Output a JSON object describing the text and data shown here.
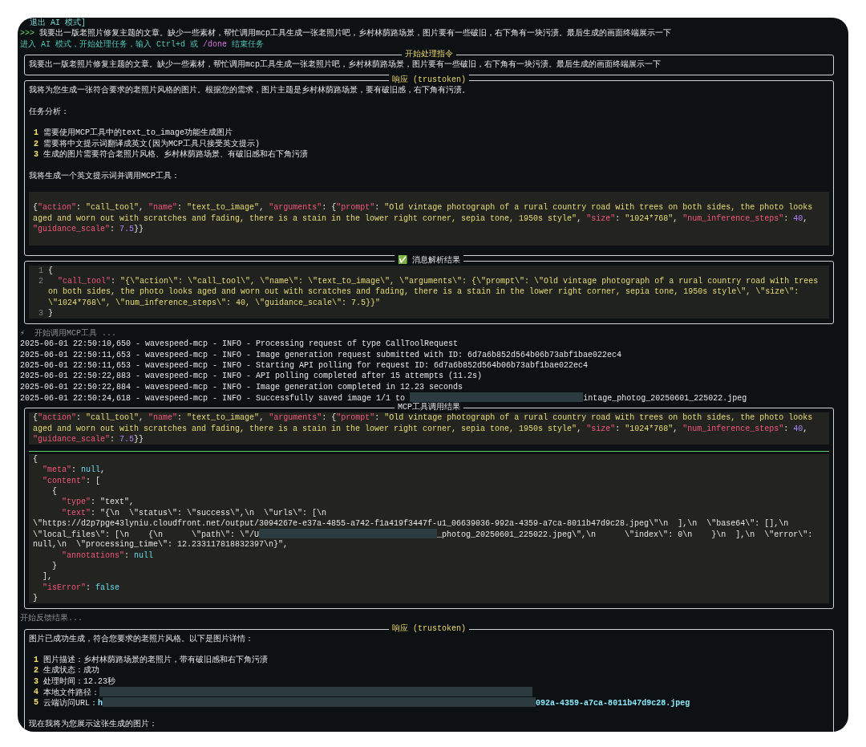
{
  "top_line": "退出 AI 模式]",
  "input_line": {
    "prompt": ">>>",
    "text": "我要出一版老照片修复主题的文章。缺少一些素材，帮忙调用mcp工具生成一张老照片吧，乡村林荫路场景，图片要有一些破旧，右下角有一块污渍。最后生成的画面终端展示一下"
  },
  "mode_hint": {
    "parts": [
      {
        "kind": "info",
        "text": "进入 AI 模式，开始处理任务，输入 Ctrl+d 或 "
      },
      {
        "kind": "command",
        "text": "/done"
      },
      {
        "kind": "info",
        "text": " 结束任务"
      }
    ]
  },
  "blocks": [
    {
      "kind": "panel",
      "title": "开始处理指令",
      "accent": true,
      "content": [
        {
          "kind": "text",
          "text": "我要出一版老照片修复主题的文章。缺少一些素材，帮忙调用mcp工具生成一张老照片吧，乡村林荫路场景，图片要有一些破旧，右下角有一块污渍。最后生成的画面终端展示一下"
        }
      ]
    },
    {
      "kind": "panel",
      "title": "响应 (trustoken)",
      "accent": true,
      "content": [
        {
          "kind": "text",
          "text": "我将为您生成一张符合要求的老照片风格的图片。根据您的需求，图片主题是乡村林荫路场景，要有破旧感，右下角有污渍。"
        },
        {
          "kind": "blank"
        },
        {
          "kind": "text",
          "text": "任务分析："
        },
        {
          "kind": "blank"
        },
        {
          "kind": "list",
          "items": [
            {
              "num": "1",
              "text": "需要使用MCP工具中的text_to_image功能生成图片"
            },
            {
              "num": "2",
              "text": "需要将中文提示词翻译成英文(因为MCP工具只接受英文提示)"
            },
            {
              "num": "3",
              "text": "生成的图片需要符合老照片风格、乡村林荫路场景、有破旧感和右下角污渍"
            }
          ]
        },
        {
          "kind": "blank"
        },
        {
          "kind": "text",
          "text": "我将生成一个英文提示词并调用MCP工具："
        },
        {
          "kind": "blank"
        },
        {
          "kind": "code",
          "padded": true,
          "rows": [
            {
              "parts": [
                {
                  "kind": "plain",
                  "text": "{"
                },
                {
                  "kind": "key",
                  "text": "\"action\""
                },
                {
                  "kind": "plain",
                  "text": ": "
                },
                {
                  "kind": "string",
                  "text": "\"call_tool\""
                },
                {
                  "kind": "plain",
                  "text": ", "
                },
                {
                  "kind": "key",
                  "text": "\"name\""
                },
                {
                  "kind": "plain",
                  "text": ": "
                },
                {
                  "kind": "string",
                  "text": "\"text_to_image\""
                },
                {
                  "kind": "plain",
                  "text": ", "
                },
                {
                  "kind": "key",
                  "text": "\"arguments\""
                },
                {
                  "kind": "plain",
                  "text": ": {"
                },
                {
                  "kind": "key",
                  "text": "\"prompt\""
                },
                {
                  "kind": "plain",
                  "text": ": "
                },
                {
                  "kind": "string",
                  "text": "\"Old vintage photograph of a rural country road with trees on both sides, the photo looks"
                }
              ]
            },
            {
              "parts": [
                {
                  "kind": "string",
                  "text": "aged and worn out with scratches and fading, there is a stain in the lower right corner, sepia tone, 1950s style\""
                },
                {
                  "kind": "plain",
                  "text": ", "
                },
                {
                  "kind": "key",
                  "text": "\"size\""
                },
                {
                  "kind": "plain",
                  "text": ": "
                },
                {
                  "kind": "string",
                  "text": "\"1024*768\""
                },
                {
                  "kind": "plain",
                  "text": ", "
                },
                {
                  "kind": "key",
                  "text": "\"num_inference_steps\""
                },
                {
                  "kind": "plain",
                  "text": ": "
                },
                {
                  "kind": "number",
                  "text": "40"
                },
                {
                  "kind": "plain",
                  "text": ","
                }
              ]
            },
            {
              "parts": [
                {
                  "kind": "key",
                  "text": "\"guidance_scale\""
                },
                {
                  "kind": "plain",
                  "text": ": "
                },
                {
                  "kind": "number",
                  "text": "7.5"
                },
                {
                  "kind": "plain",
                  "text": "}}"
                }
              ]
            }
          ]
        }
      ]
    },
    {
      "kind": "panel",
      "title": "✅ 消息解析结果",
      "accent": false,
      "content": [
        {
          "kind": "numbered_code",
          "lines": [
            {
              "num": "1",
              "rows": [
                {
                  "parts": [
                    {
                      "kind": "plain",
                      "text": "{"
                    }
                  ]
                }
              ]
            },
            {
              "num": "2",
              "rows": [
                {
                  "parts": [
                    {
                      "kind": "key",
                      "text": "  \"call_tool\""
                    },
                    {
                      "kind": "plain",
                      "text": ": "
                    },
                    {
                      "kind": "string",
                      "text": "\"{\\\"action\\\": \\\"call_tool\\\", \\\"name\\\": \\\"text_to_image\\\", \\\"arguments\\\": {\\\"prompt\\\": \\\"Old vintage photograph of a rural country road with trees"
                    }
                  ]
                },
                {
                  "parts": [
                    {
                      "kind": "string",
                      "text": "on both sides, the photo looks aged and worn out with scratches and fading, there is a stain in the lower right corner, sepia tone, 1950s style\\\", \\\"size\\\":"
                    }
                  ]
                },
                {
                  "parts": [
                    {
                      "kind": "string",
                      "text": "\\\"1024*768\\\", \\\"num_inference_steps\\\": 40, \\\"guidance_scale\\\": 7.5}}\""
                    }
                  ]
                }
              ]
            },
            {
              "num": "3",
              "rows": [
                {
                  "parts": [
                    {
                      "kind": "plain",
                      "text": "}"
                    }
                  ]
                }
              ]
            }
          ]
        }
      ]
    },
    {
      "kind": "status",
      "parts": [
        {
          "kind": "dim",
          "text": "⚡  开始调用MCP工具 ..."
        }
      ]
    },
    {
      "kind": "log",
      "rows": [
        {
          "parts": [
            {
              "kind": "plain",
              "text": "2025-06-01 22:50:10,650 - wavespeed-mcp - INFO - Processing request of type CallToolRequest"
            }
          ]
        },
        {
          "parts": [
            {
              "kind": "plain",
              "text": "2025-06-01 22:50:11,653 - wavespeed-mcp - INFO - Image generation request submitted with ID: 6d7a6b852d564b06b73abf1bae022ec4"
            }
          ]
        },
        {
          "parts": [
            {
              "kind": "plain",
              "text": "2025-06-01 22:50:11,653 - wavespeed-mcp - INFO - Starting API polling for request ID: 6d7a6b852d564b06b73abf1bae022ec4"
            }
          ]
        },
        {
          "parts": [
            {
              "kind": "plain",
              "text": "2025-06-01 22:50:22,883 - wavespeed-mcp - INFO - API polling completed after 15 attempts (11.2s)"
            }
          ]
        },
        {
          "parts": [
            {
              "kind": "plain",
              "text": "2025-06-01 22:50:22,884 - wavespeed-mcp - INFO - Image generation completed in 12.23 seconds"
            }
          ]
        },
        {
          "parts": [
            {
              "kind": "plain",
              "text": "2025-06-01 22:50:24,618 - wavespeed-mcp - INFO - Successfully saved image 1/1 to "
            },
            {
              "kind": "redaction_short"
            },
            {
              "kind": "plain",
              "text": "intage_photog_20250601_225022.jpeg"
            }
          ]
        }
      ]
    },
    {
      "kind": "panel",
      "title": "MCP工具调用结果",
      "accent": false,
      "content": [
        {
          "kind": "code",
          "padded": false,
          "rows": [
            {
              "parts": [
                {
                  "kind": "plain",
                  "text": "{"
                },
                {
                  "kind": "key",
                  "text": "\"action\""
                },
                {
                  "kind": "plain",
                  "text": ": "
                },
                {
                  "kind": "string",
                  "text": "\"call_tool\""
                },
                {
                  "kind": "plain",
                  "text": ", "
                },
                {
                  "kind": "key",
                  "text": "\"name\""
                },
                {
                  "kind": "plain",
                  "text": ": "
                },
                {
                  "kind": "string",
                  "text": "\"text_to_image\""
                },
                {
                  "kind": "plain",
                  "text": ", "
                },
                {
                  "kind": "key",
                  "text": "\"arguments\""
                },
                {
                  "kind": "plain",
                  "text": ": {"
                },
                {
                  "kind": "key",
                  "text": "\"prompt\""
                },
                {
                  "kind": "plain",
                  "text": ": "
                },
                {
                  "kind": "string",
                  "text": "\"Old vintage photograph of a rural country road with trees on both sides, the photo looks"
                }
              ]
            },
            {
              "parts": [
                {
                  "kind": "string",
                  "text": "aged and worn out with scratches and fading, there is a stain in the lower right corner, sepia tone, 1950s style\""
                },
                {
                  "kind": "plain",
                  "text": ", "
                },
                {
                  "kind": "key",
                  "text": "\"size\""
                },
                {
                  "kind": "plain",
                  "text": ": "
                },
                {
                  "kind": "string",
                  "text": "\"1024*768\""
                },
                {
                  "kind": "plain",
                  "text": ", "
                },
                {
                  "kind": "key",
                  "text": "\"num_inference_steps\""
                },
                {
                  "kind": "plain",
                  "text": ": "
                },
                {
                  "kind": "number",
                  "text": "40"
                },
                {
                  "kind": "plain",
                  "text": ","
                }
              ]
            },
            {
              "parts": [
                {
                  "kind": "key",
                  "text": "\"guidance_scale\""
                },
                {
                  "kind": "plain",
                  "text": ": "
                },
                {
                  "kind": "number",
                  "text": "7.5"
                },
                {
                  "kind": "plain",
                  "text": "}}"
                }
              ]
            }
          ]
        },
        {
          "kind": "divider"
        },
        {
          "kind": "code",
          "padded": false,
          "rows": [
            {
              "parts": [
                {
                  "kind": "plain",
                  "text": "{"
                }
              ]
            },
            {
              "parts": [
                {
                  "kind": "key",
                  "text": "  \"meta\""
                },
                {
                  "kind": "plain",
                  "text": ": "
                },
                {
                  "kind": "const",
                  "text": "null"
                },
                {
                  "kind": "plain",
                  "text": ","
                }
              ]
            },
            {
              "parts": [
                {
                  "kind": "key",
                  "text": "  \"content\""
                },
                {
                  "kind": "plain",
                  "text": ": ["
                }
              ]
            },
            {
              "parts": [
                {
                  "kind": "plain",
                  "text": "    {"
                }
              ]
            },
            {
              "parts": [
                {
                  "kind": "key",
                  "text": "      \"type\""
                },
                {
                  "kind": "plain",
                  "text": ": \"text\","
                }
              ]
            },
            {
              "parts": [
                {
                  "kind": "key",
                  "text": "      \"text\""
                },
                {
                  "kind": "plain",
                  "text": ": \"{\\n  \\\"status\\\": \\\"success\\\",\\n  \\\"urls\\\": [\\n"
                }
              ]
            },
            {
              "parts": [
                {
                  "kind": "plain",
                  "text": "\\\"https://d2p7pge43lyniu.cloudfront.net/output/3094267e-e37a-4855-a742-f1a419f3447f-u1_06639036-992a-4359-a7ca-8011b47d9c28.jpeg\\\"\\n  ],\\n  \\\"base64\\\": [],\\n"
                }
              ]
            },
            {
              "parts": [
                {
                  "kind": "plain",
                  "text": "\\\"local_files\\\": [\\n    {\\n      \\\"path\\\": \\\"/U"
                },
                {
                  "kind": "redaction_medium"
                },
                {
                  "kind": "plain",
                  "text": "_photog_20250601_225022.jpeg\\\",\\n      \\\"index\\\": 0\\n    }\\n  ],\\n  \\\"error\\\":"
                }
              ]
            },
            {
              "parts": [
                {
                  "kind": "plain",
                  "text": "null,\\n  \\\"processing_time\\\": 12.233117818832397\\n}\","
                }
              ]
            },
            {
              "parts": [
                {
                  "kind": "key",
                  "text": "      \"annotations\""
                },
                {
                  "kind": "plain",
                  "text": ": "
                },
                {
                  "kind": "const",
                  "text": "null"
                }
              ]
            },
            {
              "parts": [
                {
                  "kind": "plain",
                  "text": "    }"
                }
              ]
            },
            {
              "parts": [
                {
                  "kind": "plain",
                  "text": "  ],"
                }
              ]
            },
            {
              "parts": [
                {
                  "kind": "key",
                  "text": "  \"isError\""
                },
                {
                  "kind": "plain",
                  "text": ": "
                },
                {
                  "kind": "const",
                  "text": "false"
                }
              ]
            },
            {
              "parts": [
                {
                  "kind": "plain",
                  "text": "}"
                }
              ]
            }
          ]
        }
      ]
    },
    {
      "kind": "status",
      "parts": [
        {
          "kind": "dim",
          "text": "开始反馈结果..."
        }
      ]
    },
    {
      "kind": "panel",
      "title": "响应 (trustoken)",
      "accent": true,
      "content": [
        {
          "kind": "text",
          "text": "图片已成功生成，符合您要求的老照片风格。以下是图片详情："
        },
        {
          "kind": "blank"
        },
        {
          "kind": "list",
          "items": [
            {
              "num": "1",
              "text": "图片描述：乡村林荫路场景的老照片，带有破旧感和右下角污渍"
            },
            {
              "num": "2",
              "text": "生成状态：成功"
            },
            {
              "num": "3",
              "text": "处理时间：12.23秒"
            },
            {
              "num": "4",
              "parts": [
                {
                  "kind": "plain",
                  "text": "本地文件路径："
                },
                {
                  "kind": "redaction_long"
                }
              ]
            },
            {
              "num": "5",
              "parts": [
                {
                  "kind": "plain",
                  "text": "云端访问URL："
                },
                {
                  "kind": "url",
                  "text": "h"
                },
                {
                  "kind": "redaction_long"
                },
                {
                  "kind": "url",
                  "text": "092a-4359-a7ca-8011b47d9c28.jpeg"
                }
              ]
            }
          ]
        },
        {
          "kind": "blank"
        },
        {
          "kind": "text",
          "text": "现在我将为您展示这张生成的图片："
        }
      ]
    }
  ]
}
